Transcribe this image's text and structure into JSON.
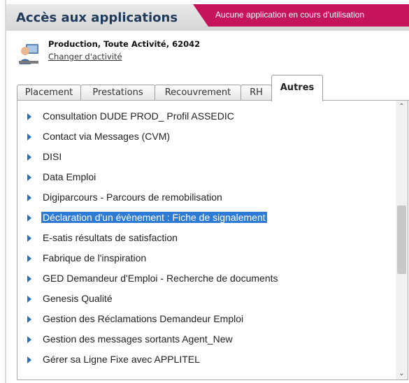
{
  "header": {
    "title": "Accès aux applications",
    "status": "Aucune application en cours d'utilisation",
    "accent_color": "#c5145c"
  },
  "activity": {
    "title": "Production, Toute Activité, 62042",
    "link": "Changer d'activité",
    "avatar_icon": "user-avatar-icon"
  },
  "tabs": [
    {
      "label": "Placement",
      "active": false
    },
    {
      "label": "Prestations",
      "active": false
    },
    {
      "label": "Recouvrement",
      "active": false
    },
    {
      "label": "RH",
      "active": false
    },
    {
      "label": "Autres",
      "active": true
    }
  ],
  "applications": [
    {
      "label": "Consultation DUDE PROD_ Profil ASSEDIC",
      "selected": false
    },
    {
      "label": "Contact via Messages (CVM)",
      "selected": false
    },
    {
      "label": "DISI",
      "selected": false
    },
    {
      "label": "Data Emploi",
      "selected": false
    },
    {
      "label": "Digiparcours - Parcours de remobilisation",
      "selected": false
    },
    {
      "label": "Déclaration d'un évènement : Fiche de signalement",
      "selected": true
    },
    {
      "label": "E-satis résultats de satisfaction",
      "selected": false
    },
    {
      "label": "Fabrique de l'inspiration",
      "selected": false
    },
    {
      "label": "GED Demandeur d'Emploi - Recherche de documents",
      "selected": false
    },
    {
      "label": "Genesis Qualité",
      "selected": false
    },
    {
      "label": "Gestion des Réclamations Demandeur Emploi",
      "selected": false
    },
    {
      "label": "Gestion des messages sortants Agent_New",
      "selected": false
    },
    {
      "label": "Gérer sa Ligne Fixe avec APPLITEL",
      "selected": false
    }
  ],
  "scrollbar": {
    "up_icon": "chevron-up-icon",
    "down_icon": "chevron-down-icon"
  }
}
